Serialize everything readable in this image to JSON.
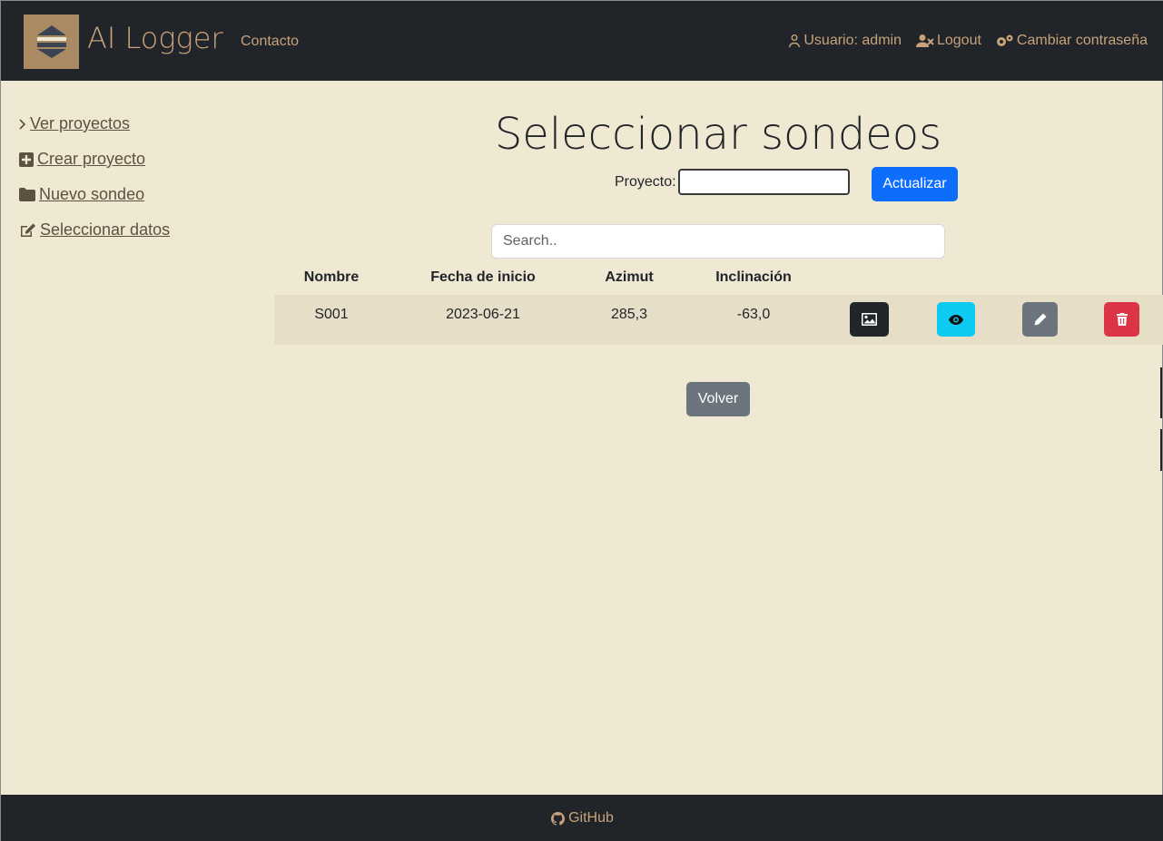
{
  "navbar": {
    "brand": "AI Logger",
    "contact": "Contacto",
    "user": "Usuario: admin",
    "logout": "Logout",
    "change_password": "Cambiar contraseña"
  },
  "sidebar": {
    "items": [
      {
        "label": " Ver proyectos",
        "icon": "chevron-right-icon"
      },
      {
        "label": " Crear proyecto",
        "icon": "plus-square-icon"
      },
      {
        "label": " Nuevo sondeo",
        "icon": "folder-icon"
      },
      {
        "label": " Seleccionar datos",
        "icon": "edit-icon"
      }
    ]
  },
  "main": {
    "title": "Seleccionar sondeos",
    "project_label": "Proyecto:",
    "project_value": "",
    "update_button": "Actualizar",
    "search_placeholder": "Search..",
    "table": {
      "headers": [
        "Nombre",
        "Fecha de inicio",
        "Azimut",
        "Inclinación"
      ],
      "rows": [
        {
          "nombre": "S001",
          "fecha": "2023-06-21",
          "azimut": "285,3",
          "inclinacion": "-63,0"
        }
      ],
      "actions": [
        "image-icon",
        "eye-icon",
        "pencil-icon",
        "trash-icon"
      ]
    },
    "back_button": "Volver"
  },
  "footer": {
    "link": "GitHub"
  },
  "colors": {
    "background": "#efe8d2",
    "navbar": "#212429",
    "accent": "#c8a27a",
    "primary": "#0d6efd",
    "info": "#0dcaf0",
    "secondary": "#6c757d",
    "danger": "#dc3545"
  }
}
